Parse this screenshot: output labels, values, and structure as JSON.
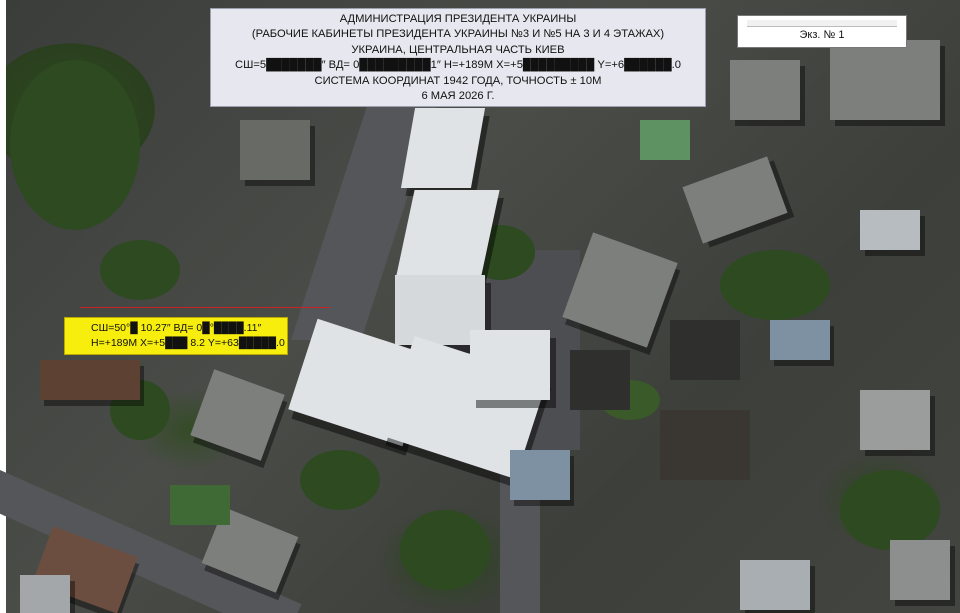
{
  "title_block": {
    "line1": "АДМИНИСТРАЦИЯ ПРЕЗИДЕНТА УКРАИНЫ",
    "line2": "(РАБОЧИЕ КАБИНЕТЫ ПРЕЗИДЕНТА УКРАИНЫ №3 И №5 НА 3 И 4 ЭТАЖАХ)",
    "line3": "УКРАИНА, ЦЕНТРАЛЬНАЯ ЧАСТЬ КИЕВ",
    "line4": "СШ=5███████″ ВД= 0█████████1″ Н=+189М Х=+5█████████ Y=+6██████.0",
    "line5": "СИСТЕМА КООРДИНАТ 1942 ГОДА, ТОЧНОСТЬ ± 10М",
    "line6": "6 МАЯ 2026 Г."
  },
  "copy_label": {
    "text": "Экз. № 1"
  },
  "target_label": {
    "line1": "СШ=50°█ 10.27″ ВД= 0█°████.11″",
    "line2": "Н=+189М Х=+5███ 8.2 Y=+63█████.0"
  },
  "colors": {
    "label_yellow": "#f7ee0d",
    "leader_red": "#c92222",
    "title_bg": "#e7e8ef"
  }
}
